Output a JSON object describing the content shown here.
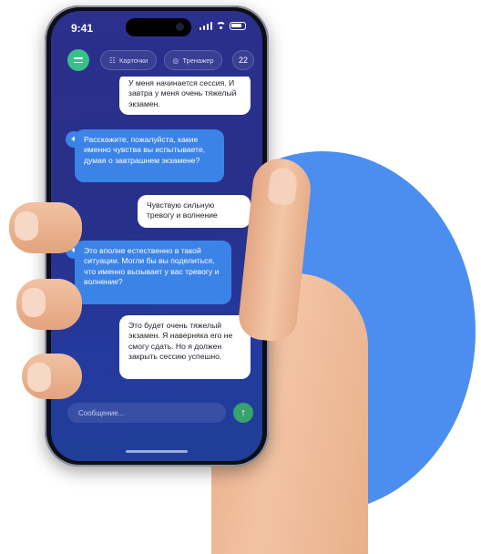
{
  "status_bar": {
    "time": "9:41"
  },
  "header": {
    "menu_icon": "hamburger-icon",
    "cards_label": "Карточки",
    "cards_icon": "cards-icon",
    "trainer_label": "Тренажер",
    "trainer_icon": "trainer-icon",
    "counter": "22"
  },
  "messages": [
    {
      "role": "user",
      "text": "У меня начинается сессия. И завтра у меня очень тяжелый экзамен."
    },
    {
      "role": "assistant",
      "text": "Расскажите, пожалуйста, какие именно чувства вы испытываете, думая о завтрашнем экзамене?"
    },
    {
      "role": "user",
      "text": "Чувствую сильную тревогу и волнение"
    },
    {
      "role": "assistant",
      "text": "Это вполне естественно в такой ситуации. Могли бы вы поделиться, что именно вызывает у вас тревогу и волнение?"
    },
    {
      "role": "user",
      "text": "Это будет очень тяжелый экзамен. Я наверняка его не смогу сдать. Но я должен закрыть сессию успешно."
    }
  ],
  "composer": {
    "placeholder": "Сообщение...",
    "send_icon": "arrow-up-icon"
  },
  "colors": {
    "accent_green": "#3bbf8a",
    "bot_bubble": "#3b83e6",
    "user_bubble": "#ffffff",
    "screen_bg": "#2a3190",
    "backdrop_circle": "#4c8ef0"
  }
}
